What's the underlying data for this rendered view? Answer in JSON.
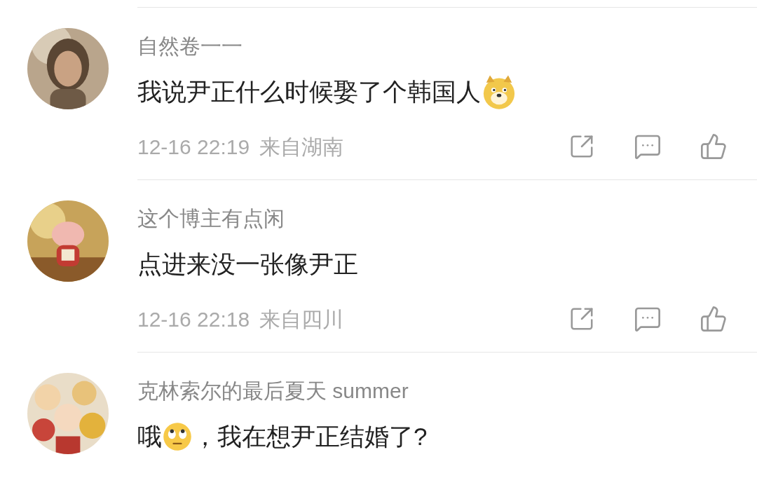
{
  "comments": [
    {
      "avatar": {
        "kind": "picture"
      },
      "name": "自然卷一一",
      "content": [
        {
          "kind": "text",
          "text": "我说尹正什么时候娶了个韩国人"
        },
        {
          "kind": "doge"
        }
      ],
      "time": "12-16 22:19",
      "location": "来自湖南"
    },
    {
      "avatar": {
        "kind": "picture"
      },
      "name": "这个博主有点闲",
      "content": [
        {
          "kind": "text",
          "text": "点进来没一张像尹正"
        }
      ],
      "time": "12-16 22:18",
      "location": "来自四川"
    },
    {
      "avatar": {
        "kind": "picture"
      },
      "name": "克林索尔的最后夏天 summer",
      "content": [
        {
          "kind": "text",
          "text": "哦"
        },
        {
          "kind": "rolleyes"
        },
        {
          "kind": "text",
          "text": "，我在想尹正结婚了?"
        }
      ]
    }
  ]
}
